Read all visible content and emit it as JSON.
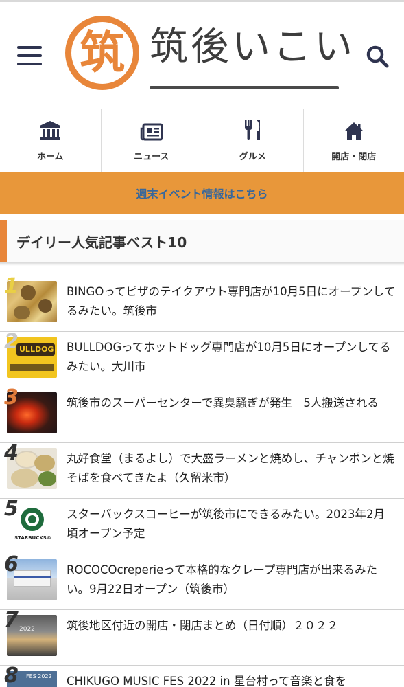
{
  "site": {
    "logo_kanji": "筑",
    "logo_text": "筑後いこい"
  },
  "nav": {
    "items": [
      {
        "label": "ホーム",
        "icon": "bank-icon"
      },
      {
        "label": "ニュース",
        "icon": "newspaper-icon"
      },
      {
        "label": "グルメ",
        "icon": "fork-knife-icon"
      },
      {
        "label": "開店・閉店",
        "icon": "home-icon"
      }
    ]
  },
  "banner": {
    "label": "週末イベント情報はこちら"
  },
  "section": {
    "title": "デイリー人気記事ベスト10"
  },
  "articles": [
    {
      "rank": "1",
      "title": "BINGOってピザのテイクアウト専門店が10月5日にオープンしてるみたい。筑後市",
      "rank_color": "#e9cf45"
    },
    {
      "rank": "2",
      "title": "BULLDOGってホットドッグ専門店が10月5日にオープンしてるみたい。大川市",
      "rank_color": "#c9c9c9"
    },
    {
      "rank": "3",
      "title": "筑後市のスーパーセンターで異臭騒ぎが発生　5人搬送される",
      "rank_color": "#e07a3a"
    },
    {
      "rank": "4",
      "title": "丸好食堂（まるよし）で大盛ラーメンと焼めし、チャンポンと焼そばを食べてきたよ（久留米市）",
      "rank_color": "#333333"
    },
    {
      "rank": "5",
      "title": "スターバックスコーヒーが筑後市にできるみたい。2023年2月頃オープン予定",
      "rank_color": "#333333",
      "thumb_text": "STARBUCKS®"
    },
    {
      "rank": "6",
      "title": "ROCOCOcreperieって本格的なクレープ専門店が出来るみたい。9月22日オープン（筑後市）",
      "rank_color": "#333333"
    },
    {
      "rank": "7",
      "title": "筑後地区付近の開店・閉店まとめ（日付順）２０２２",
      "rank_color": "#333333",
      "thumb_text": "2022"
    },
    {
      "rank": "8",
      "title": "CHIKUGO MUSIC FES 2022 in 星台村って音楽と食を",
      "rank_color": "#333333",
      "thumb_text": "FES 2022"
    }
  ],
  "colors": {
    "accent_orange": "#e8863a",
    "banner_bg": "#e8973a",
    "banner_text": "#36679c",
    "nav_icon": "#2f3450"
  }
}
